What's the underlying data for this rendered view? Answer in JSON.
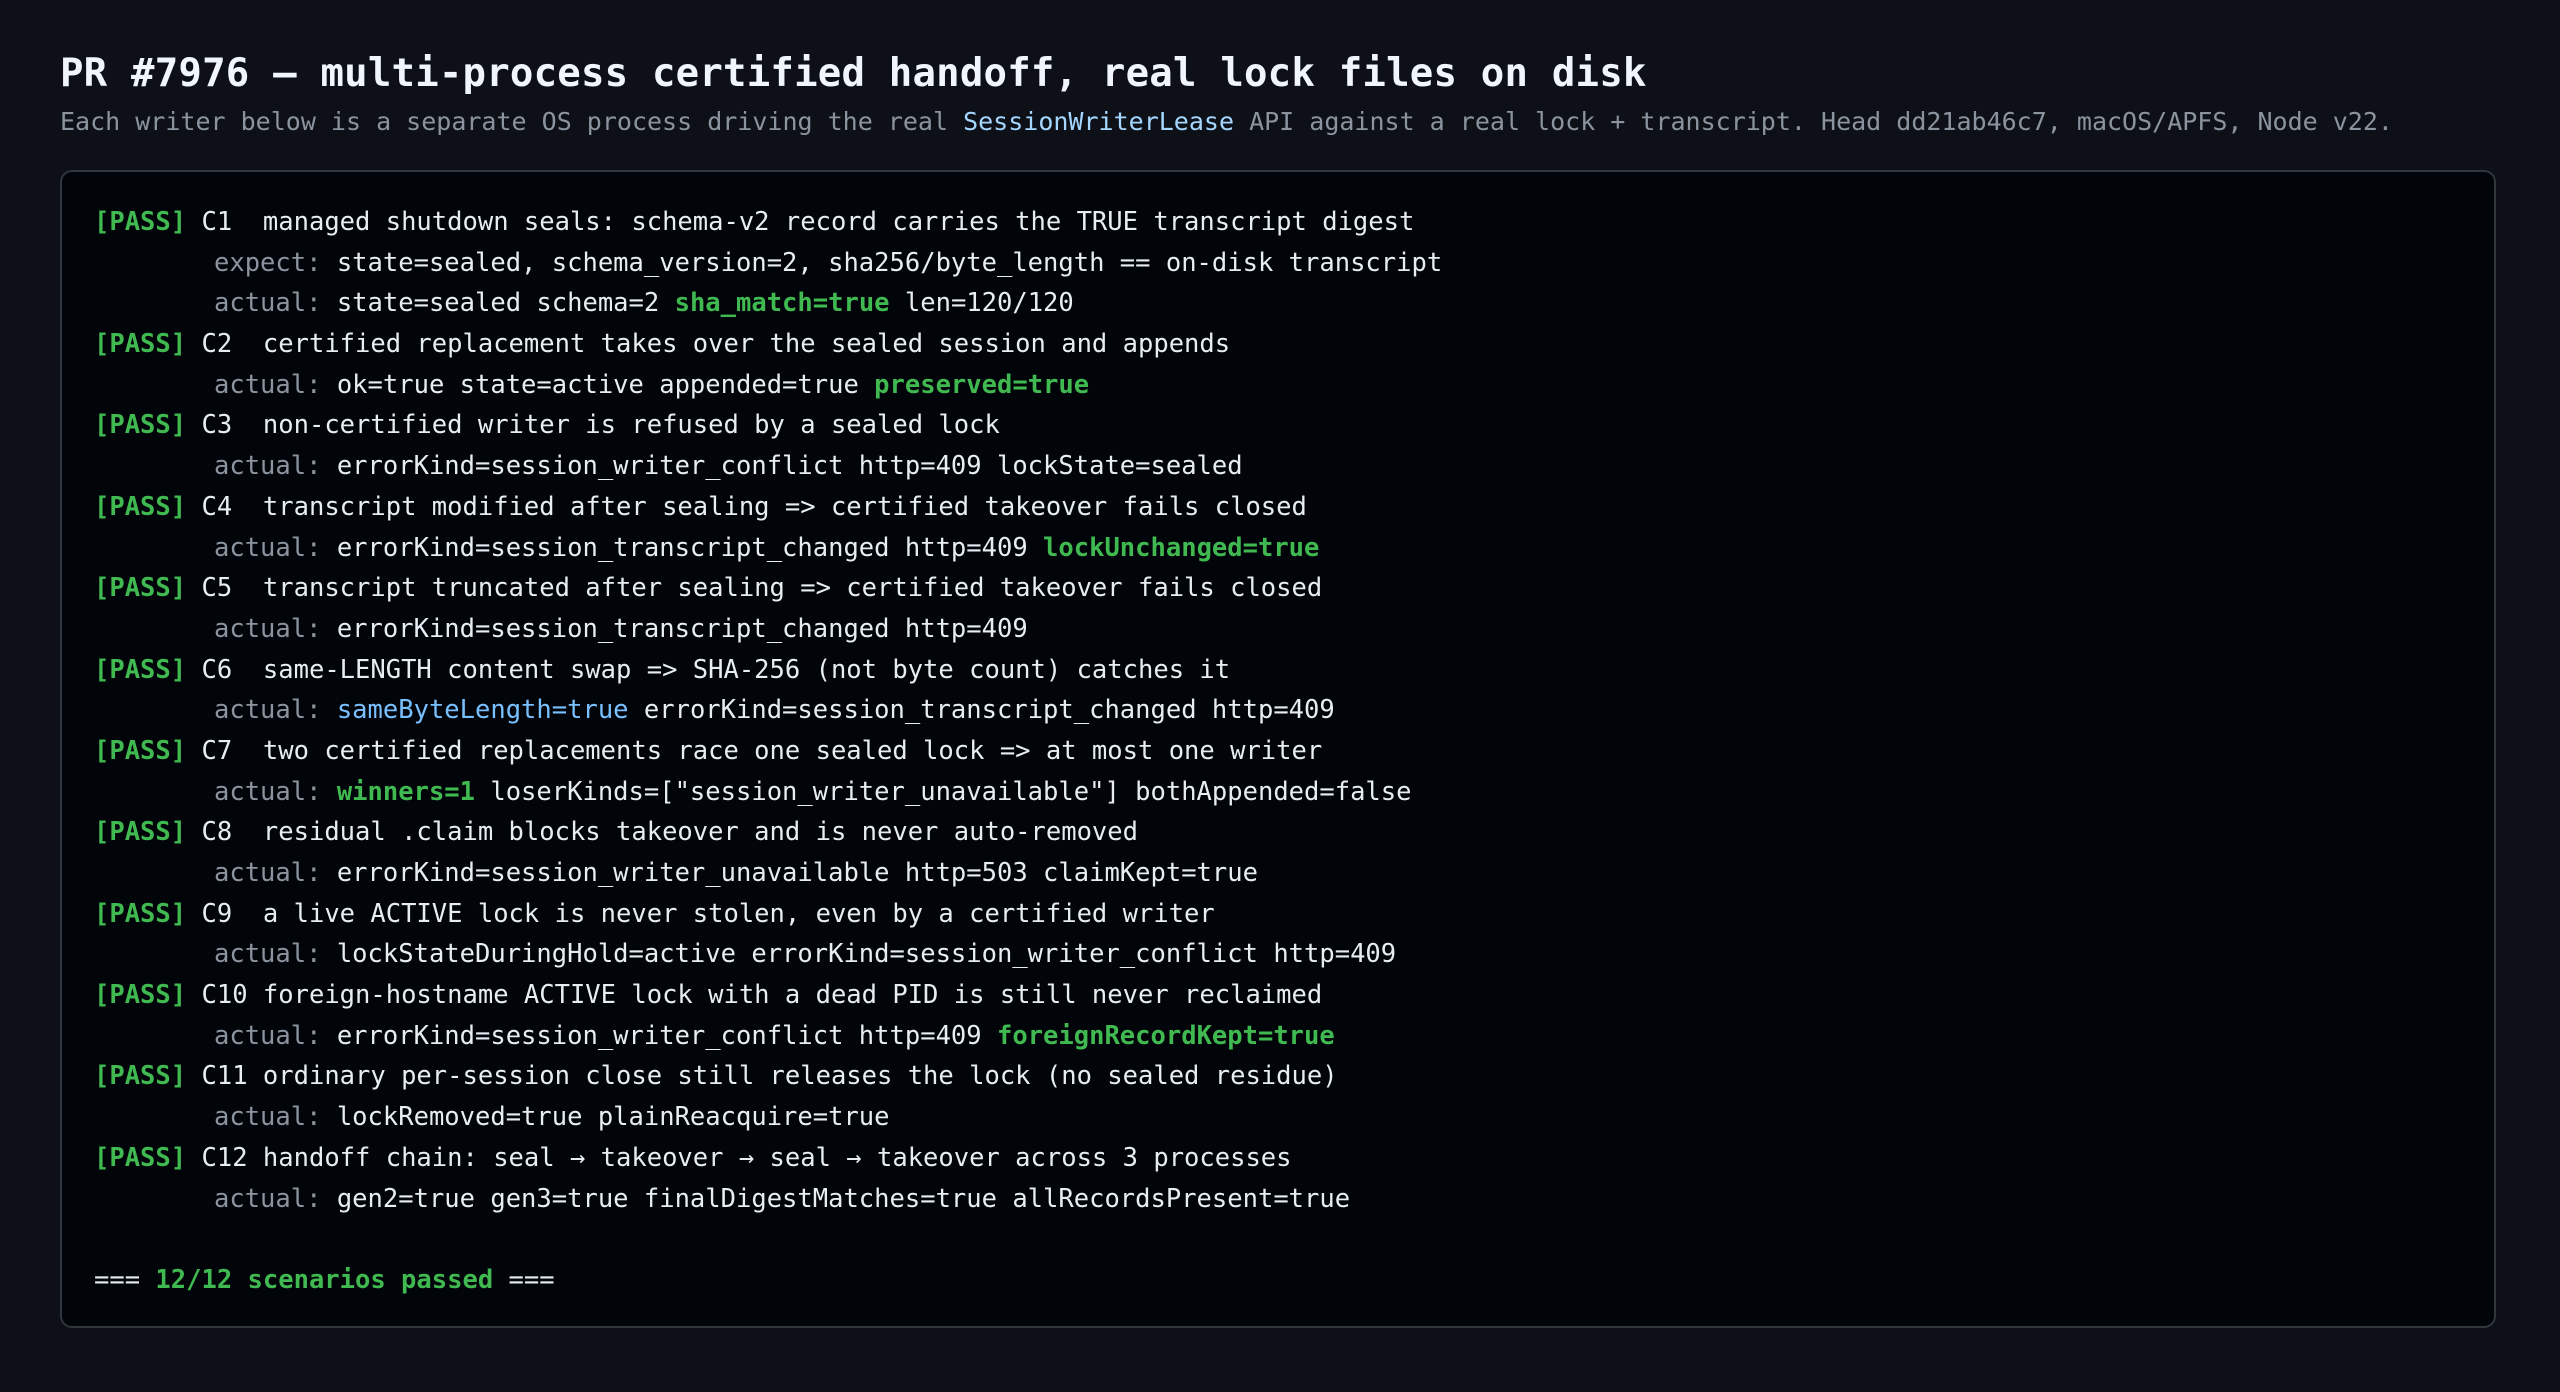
{
  "header": {
    "title": "PR #7976 — multi-process certified handoff, real lock files on disk",
    "subtitle_pre": "Each writer below is a separate OS process driving the real ",
    "subtitle_api": "SessionWriterLease",
    "subtitle_post": " API against a real lock + transcript. Head dd21ab46c7, macOS/APFS, Node v22."
  },
  "terminal": {
    "pass_tag": "[PASS]",
    "expect_label": "expect:",
    "actual_label": "actual:",
    "scenarios": [
      {
        "id": "C1 ",
        "desc": "managed shutdown seals: schema-v2 record carries the TRUE transcript digest",
        "expect": "state=sealed, schema_version=2, sha256/byte_length == on-disk transcript",
        "actual_pre": "state=sealed schema=2 ",
        "actual_hl": "sha_match=true",
        "actual_post": " len=120/120"
      },
      {
        "id": "C2 ",
        "desc": "certified replacement takes over the sealed session and appends",
        "actual_pre": "ok=true state=active appended=true ",
        "actual_hl": "preserved=true",
        "actual_post": ""
      },
      {
        "id": "C3 ",
        "desc": "non-certified writer is refused by a sealed lock",
        "actual_pre": "errorKind=session_writer_conflict http=409 lockState=sealed",
        "actual_hl": "",
        "actual_post": ""
      },
      {
        "id": "C4 ",
        "desc": "transcript modified after sealing => certified takeover fails closed",
        "actual_pre": "errorKind=session_transcript_changed http=409 ",
        "actual_hl": "lockUnchanged=true",
        "actual_post": ""
      },
      {
        "id": "C5 ",
        "desc": "transcript truncated after sealing => certified takeover fails closed",
        "actual_pre": "errorKind=session_transcript_changed http=409",
        "actual_hl": "",
        "actual_post": ""
      },
      {
        "id": "C6 ",
        "desc": "same-LENGTH content swap => SHA-256 (not byte count) catches it",
        "actual_pre": "",
        "actual_blue": "sameByteLength=true",
        "actual_post": " errorKind=session_transcript_changed http=409"
      },
      {
        "id": "C7 ",
        "desc": "two certified replacements race one sealed lock => at most one writer",
        "actual_pre": "",
        "actual_hl": "winners=1",
        "actual_post": " loserKinds=[\"session_writer_unavailable\"] bothAppended=false"
      },
      {
        "id": "C8 ",
        "desc": "residual .claim blocks takeover and is never auto-removed",
        "actual_pre": "errorKind=session_writer_unavailable http=503 claimKept=true",
        "actual_hl": "",
        "actual_post": ""
      },
      {
        "id": "C9 ",
        "desc": "a live ACTIVE lock is never stolen, even by a certified writer",
        "actual_pre": "lockStateDuringHold=active errorKind=session_writer_conflict http=409",
        "actual_hl": "",
        "actual_post": ""
      },
      {
        "id": "C10",
        "desc": "foreign-hostname ACTIVE lock with a dead PID is still never reclaimed",
        "actual_pre": "errorKind=session_writer_conflict http=409 ",
        "actual_hl": "foreignRecordKept=true",
        "actual_post": ""
      },
      {
        "id": "C11",
        "desc": "ordinary per-session close still releases the lock (no sealed residue)",
        "actual_pre": "lockRemoved=true plainReacquire=true",
        "actual_hl": "",
        "actual_post": ""
      },
      {
        "id": "C12",
        "desc": "handoff chain: seal → takeover → seal → takeover across 3 processes",
        "actual_pre": "gen2=true gen3=true finalDigestMatches=true allRecordsPresent=true",
        "actual_hl": "",
        "actual_post": ""
      }
    ],
    "summary": {
      "prefix": "=== ",
      "count": "12/12 scenarios passed",
      "suffix": " ==="
    }
  }
}
